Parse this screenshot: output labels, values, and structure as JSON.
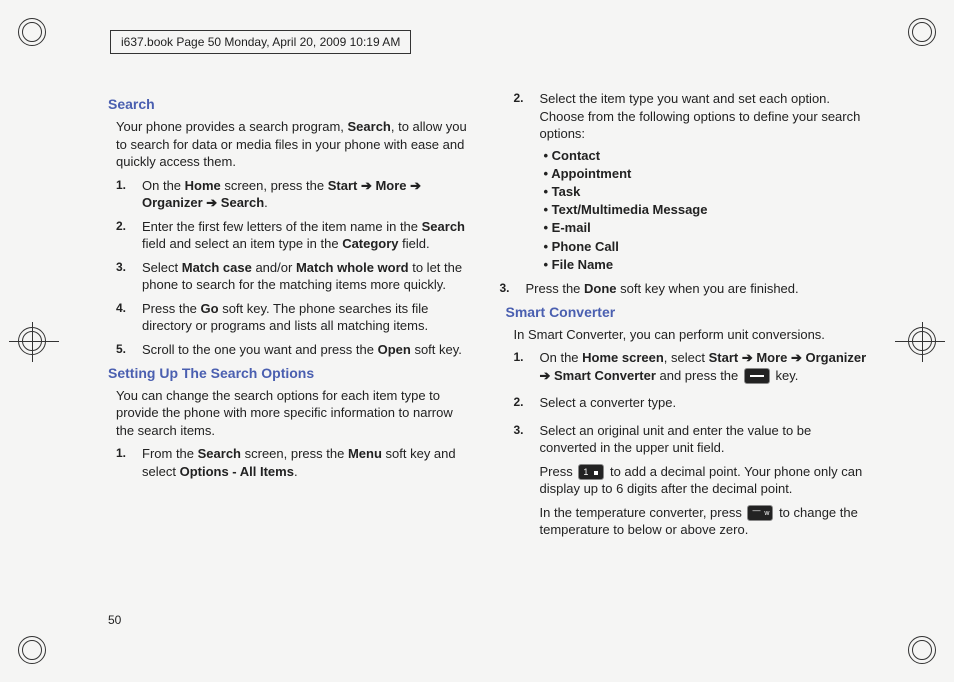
{
  "header": "i637.book  Page 50  Monday, April 20, 2009  10:19 AM",
  "page_number": "50",
  "left": {
    "h1": "Search",
    "intro": "Your phone provides a search program, __B__Search__/B__, to allow you to search for data or media files in your phone with ease and quickly access them.",
    "steps1": [
      "On the __B__Home__/B__ screen, press the __B__Start ➔ More ➔ Organizer ➔ Search__/B__.",
      "Enter the first few letters of the item name in the __B__Search__/B__ field and select an item type in the __B__Category__/B__ field.",
      "Select __B__Match case__/B__ and/or __B__Match whole word__/B__ to let the phone to search for the matching items more quickly.",
      "Press the __B__Go__/B__ soft key. The phone searches its file directory or programs and lists all matching items.",
      "Scroll to the one you want and press the __B__Open__/B__ soft key."
    ],
    "h2": "Setting Up The Search Options",
    "intro2": "You can change the search options for each item type to provide the phone with more specific information to narrow the search items.",
    "steps2": [
      "From the __B__Search__/B__ screen, press the __B__Menu__/B__ soft key and select __B__Options - All Items__/B__."
    ]
  },
  "right": {
    "step2_lead": "Select the item type you want and set each option. Choose from the following options to define your search options:",
    "bullets": [
      "Contact",
      "Appointment",
      "Task",
      "Text/Multimedia Message",
      "E-mail",
      "Phone Call",
      "File Name"
    ],
    "step3": "Press the __B__Done__/B__ soft key when you are finished.",
    "h3": "Smart Converter",
    "intro3": "In Smart Converter, you can perform unit conversions.",
    "sc_step1_a": "On the __B__Home screen__/B__, select __B__Start ➔ More ➔ Organizer ➔ Smart Converter__/B__ and press the ",
    "sc_step1_b": " key.",
    "sc_step2": "Select a converter type.",
    "sc_step3_a": "Select an original unit and enter the value to be converted in the upper unit field.",
    "sc_step3_b1": "Press ",
    "sc_step3_b2": " to add a decimal point. Your phone only can display up to 6 digits after the decimal point.",
    "sc_step3_c1": "In the temperature converter, press ",
    "sc_step3_c2": " to change the temperature to below or above zero."
  }
}
